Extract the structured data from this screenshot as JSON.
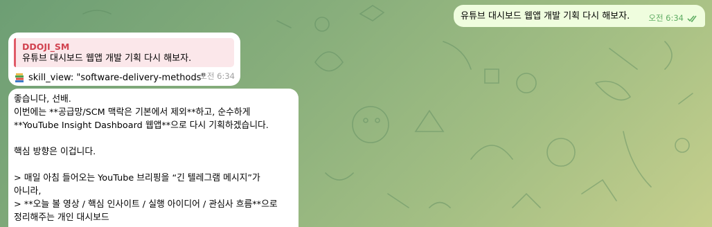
{
  "outgoing": {
    "text": "유튜브 대시보드 웹앱 개발 기획 다시 해보자.",
    "time": "오전 6:34",
    "status_icon": "double-check-icon"
  },
  "incoming_1": {
    "reply_author": "DDOJI_SM",
    "reply_text": "유튜브 대시보드 웹앱 개발 기획 다시 해보자.",
    "body_icon": "books-icon",
    "body": "skill_view: \"software-delivery-methods\"",
    "time": "오전 6:34"
  },
  "incoming_2": {
    "lines": [
      "좋습니다, 선배.",
      "이번에는 **공급망/SCM 맥락은 기본에서 제외**하고, 순수하게",
      "**YouTube Insight Dashboard 웹앱**으로 다시 기획하겠습니다.",
      "",
      "핵심 방향은 이겁니다.",
      "",
      "> 매일 아침 들어오는 YouTube 브리핑을 “긴 텔레그램 메시지”가",
      "아니라,",
      "> **오늘 볼 영상 / 핵심 인사이트 / 실행 아이디어 / 관심사 흐름**으로",
      "정리해주는 개인 대시보드"
    ]
  }
}
